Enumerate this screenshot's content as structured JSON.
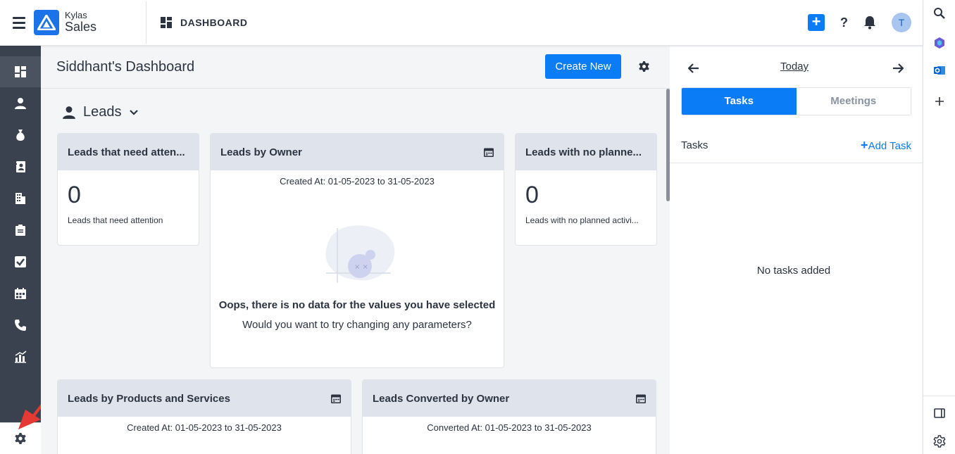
{
  "app": {
    "brand_top": "Kylas",
    "brand_bottom": "Sales",
    "breadcrumb": "DASHBOARD",
    "avatar_initial": "T",
    "help": "?"
  },
  "main": {
    "title": "Siddhant's Dashboard",
    "create_label": "Create New",
    "section_label": "Leads",
    "cards": {
      "attention": {
        "title": "Leads that need atten...",
        "value": "0",
        "label": "Leads that need attention"
      },
      "owner": {
        "title": "Leads by Owner",
        "range": "Created At: 01-05-2023 to 31-05-2023",
        "empty_title": "Oops, there is no data for the values you have selected",
        "empty_sub": "Would you want to try changing any parameters?"
      },
      "planned": {
        "title": "Leads with no planne...",
        "value": "0",
        "label": "Leads with no planned activi..."
      },
      "products": {
        "title": "Leads by Products and Services",
        "range": "Created At: 01-05-2023 to 31-05-2023"
      },
      "converted": {
        "title": "Leads Converted by Owner",
        "range": "Converted At: 01-05-2023 to 31-05-2023"
      }
    }
  },
  "right": {
    "today": "Today",
    "tabs": [
      "Tasks",
      "Meetings"
    ],
    "tasks_label": "Tasks",
    "add_task": "Add Task",
    "empty": "No tasks added"
  },
  "colors": {
    "accent": "#0a7cf5",
    "nav_bg": "#39424e",
    "card_header": "#dfe4ec",
    "annotation_arrow": "#e53935"
  }
}
